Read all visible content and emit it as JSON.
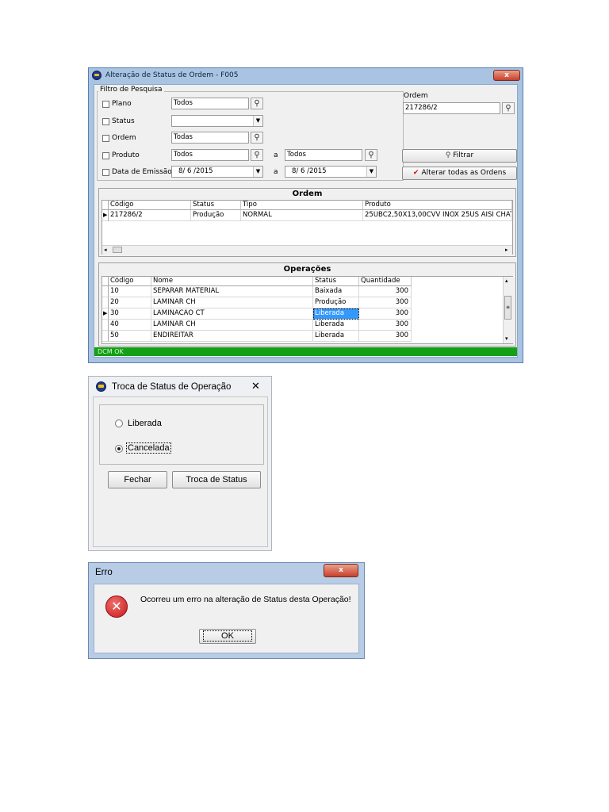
{
  "main_window": {
    "title": "Alteração de Status de Ordem - F005",
    "close_glyph": "x",
    "filter": {
      "legend": "Filtro de Pesquisa",
      "plano_label": "Plano",
      "plano_value": "Todos",
      "status_label": "Status",
      "status_value": "",
      "ordem_label": "Ordem",
      "ordem_value": "Todas",
      "produto_label": "Produto",
      "produto_from": "Todos",
      "a_label": "a",
      "produto_to": "Todos",
      "data_label": "Data de Emissão",
      "data_from": "8/ 6 /2015",
      "data_to": "8/ 6 /2015"
    },
    "ordem_search": {
      "label": "Ordem",
      "value": "217286/2"
    },
    "filtrar_label": "Filtrar",
    "alterar_label": "Alterar todas as Ordens",
    "ordem_grid": {
      "title": "Ordem",
      "headers": [
        "Código",
        "Status",
        "Tipo",
        "Produto"
      ],
      "rows": [
        {
          "codigo": "217286/2",
          "status": "Produção",
          "tipo": "NORMAL",
          "produto": "25UBC2,50X13,00CVV INOX 25US AISI CHAT"
        }
      ]
    },
    "operacoes_grid": {
      "title": "Operações",
      "headers": [
        "Código",
        "Nome",
        "Status",
        "Quantidade"
      ],
      "rows": [
        {
          "codigo": "10",
          "nome": "SEPARAR MATERIAL",
          "status": "Baixada",
          "quantidade": "300"
        },
        {
          "codigo": "20",
          "nome": "LAMINAR CH",
          "status": "Produção",
          "quantidade": "300"
        },
        {
          "codigo": "30",
          "nome": "LAMINACAO CT",
          "status": "Liberada",
          "quantidade": "300"
        },
        {
          "codigo": "40",
          "nome": "LAMINAR CH",
          "status": "Liberada",
          "quantidade": "300"
        },
        {
          "codigo": "50",
          "nome": "ENDIREITAR",
          "status": "Liberada",
          "quantidade": "300"
        }
      ]
    },
    "status_bar": "DCM OK"
  },
  "troca_dialog": {
    "title": "Troca de Status de Operação",
    "close_glyph": "✕",
    "option_liberada": "Liberada",
    "option_cancelada": "Cancelada",
    "fechar_label": "Fechar",
    "troca_label": "Troca de Status"
  },
  "erro_dialog": {
    "title": "Erro",
    "close_glyph": "x",
    "message": "Ocorreu um erro na alteração de Status desta Operação!",
    "ok_label": "OK"
  },
  "colors": {
    "title_blue": "#a9c4e3",
    "status_green": "#14a014",
    "selection": "#3399ff",
    "error_red": "#d42020"
  }
}
